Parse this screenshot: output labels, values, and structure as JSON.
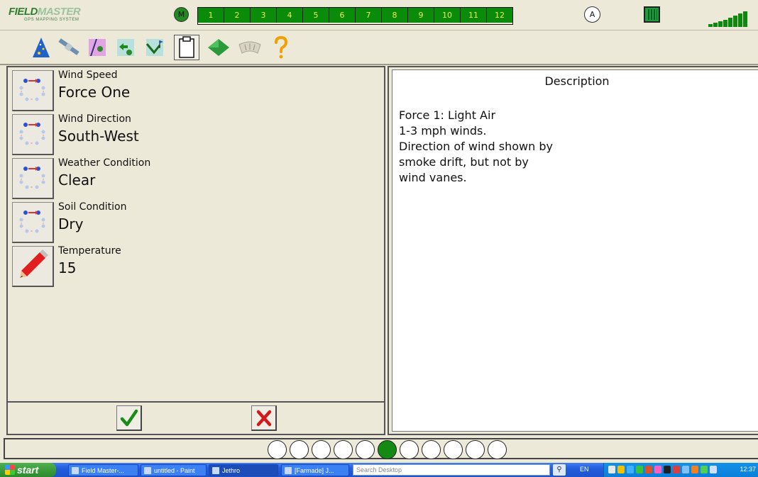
{
  "app": {
    "logo_text_bold": "FIELD",
    "logo_text_light": "MASTER",
    "logo_subtitle": "GPS MAPPING SYSTEM"
  },
  "topbar": {
    "m_label": "M",
    "numbers": [
      "1",
      "2",
      "3",
      "4",
      "5",
      "6",
      "7",
      "8",
      "9",
      "10",
      "11",
      "12"
    ],
    "a_label": "A"
  },
  "toolbar": {
    "icons": [
      "wizard-icon",
      "satellite-icon",
      "field-map-icon",
      "field-back-icon",
      "field-flag-icon",
      "clipboard-icon",
      "leaf-icon",
      "gauge-icon",
      "help-icon"
    ]
  },
  "form": {
    "rows": [
      {
        "label": "Wind Speed",
        "value": "Force One",
        "icon": "cycle-arrows-icon"
      },
      {
        "label": "Wind Direction",
        "value": "South-West",
        "icon": "cycle-arrows-icon"
      },
      {
        "label": "Weather Condition",
        "value": "Clear",
        "icon": "cycle-arrows-icon"
      },
      {
        "label": "Soil Condition",
        "value": "Dry",
        "icon": "cycle-arrows-icon"
      },
      {
        "label": "Temperature",
        "value": "15",
        "icon": "pencil-icon"
      }
    ]
  },
  "description": {
    "title": "Description",
    "lines": [
      "Force 1: Light Air",
      "1-3 mph winds.",
      "Direction of wind shown by",
      "smoke drift, but not by",
      "wind vanes."
    ]
  },
  "pager": {
    "total": 11,
    "current": 6
  },
  "taskbar": {
    "start_label": "start",
    "tasks": [
      "Field Master-...",
      "untitled - Paint",
      "Jethro",
      "[Farmade] J..."
    ],
    "search_placeholder": "Search Desktop",
    "lang": "EN",
    "clock": "12:37"
  },
  "colors": {
    "green_bar": "#0a8b0a",
    "number_text": "#f0e94c",
    "active_dot": "#138a13"
  }
}
